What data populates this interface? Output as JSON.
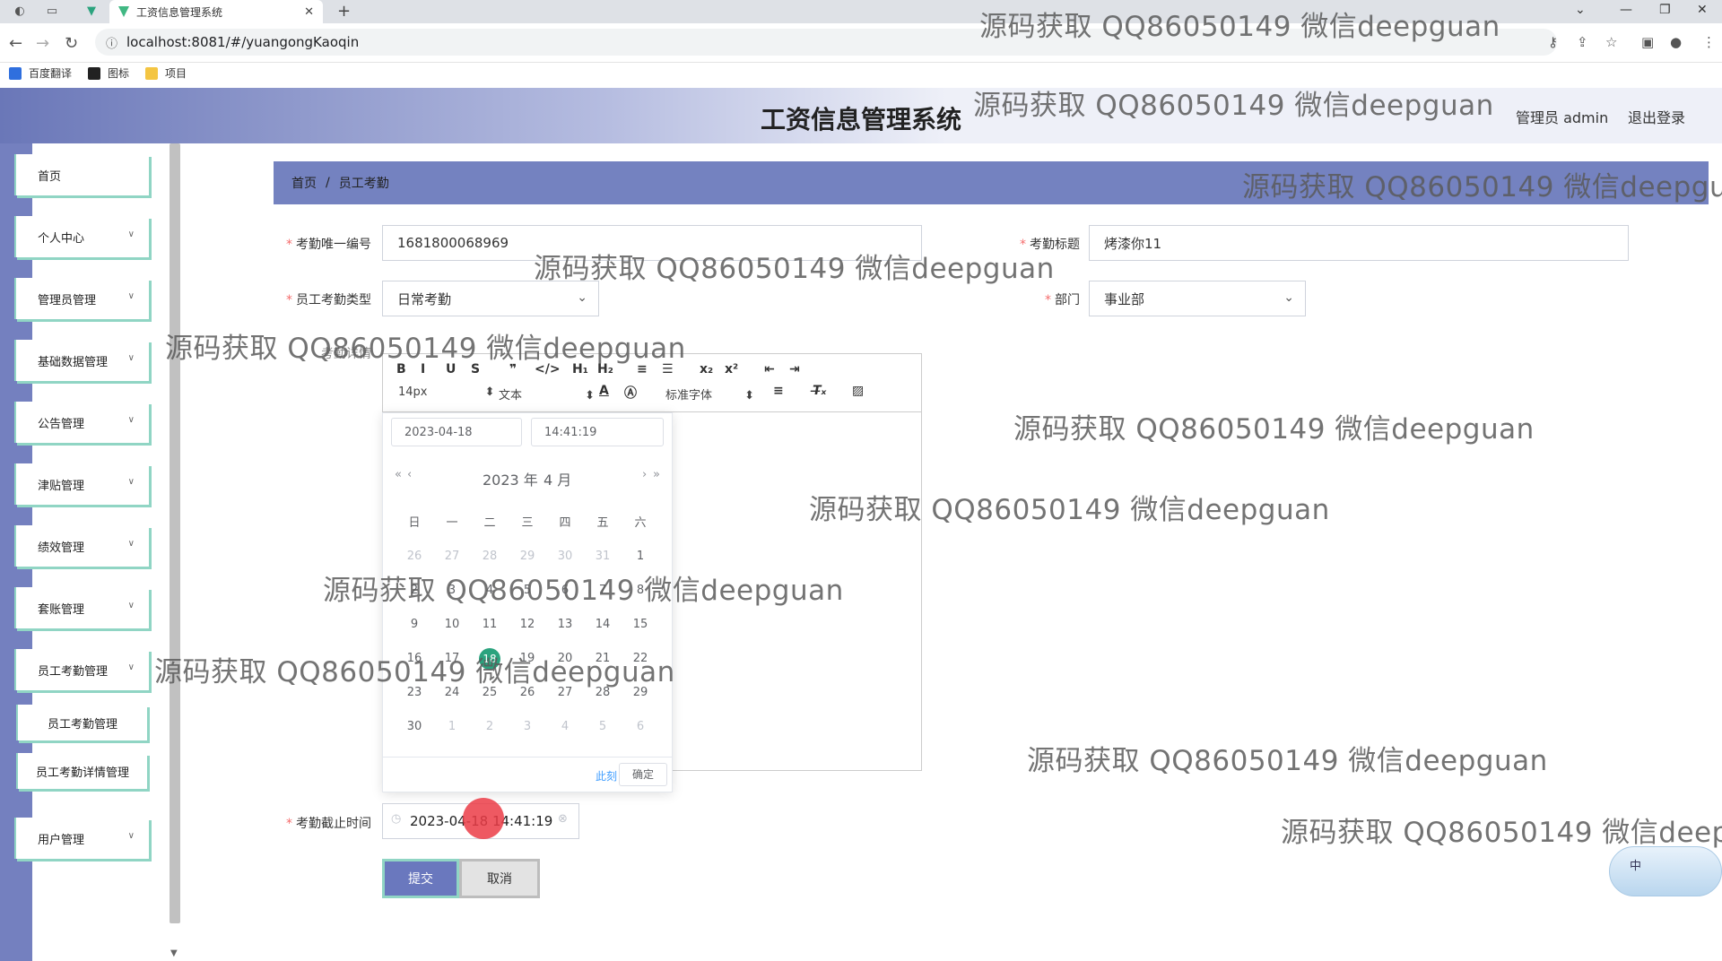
{
  "browser": {
    "tab_title": "工资信息管理系统",
    "url": "localhost:8081/#/yuangongKaoqin",
    "bookmarks": [
      {
        "label": "百度翻译",
        "color": "#2f6fde"
      },
      {
        "label": "图标",
        "color": "#222222"
      },
      {
        "label": "项目",
        "color": "#f4c542"
      }
    ]
  },
  "header": {
    "title": "工资信息管理系统",
    "user": "管理员 admin",
    "logout": "退出登录"
  },
  "sidebar": {
    "items": [
      {
        "label": "首页",
        "has_arrow": false
      },
      {
        "label": "个人中心",
        "has_arrow": true
      },
      {
        "label": "管理员管理",
        "has_arrow": true
      },
      {
        "label": "基础数据管理",
        "has_arrow": true
      },
      {
        "label": "公告管理",
        "has_arrow": true
      },
      {
        "label": "津贴管理",
        "has_arrow": true
      },
      {
        "label": "绩效管理",
        "has_arrow": true
      },
      {
        "label": "套账管理",
        "has_arrow": true
      },
      {
        "label": "员工考勤管理",
        "has_arrow": true
      }
    ],
    "subitems": [
      "员工考勤管理",
      "员工考勤详情管理"
    ],
    "last_item": "用户管理"
  },
  "breadcrumb": {
    "home": "首页",
    "sep": "/",
    "current": "员工考勤"
  },
  "form": {
    "id_label": "考勤唯一编号",
    "id_value": "1681800068969",
    "title_label": "考勤标题",
    "title_value": "烤漆你11",
    "type_label": "员工考勤类型",
    "type_value": "日常考勤",
    "dept_label": "部门",
    "dept_value": "事业部",
    "detail_label": "考勤详情",
    "deadline_label": "考勤截止时间",
    "deadline_value": "2023-04-18 14:41:19",
    "submit": "提交",
    "cancel": "取消"
  },
  "editor": {
    "tools": [
      "B",
      "I",
      "U",
      "S",
      "❞",
      "</>",
      "H₁",
      "H₂",
      "≡",
      "☰",
      "x₂",
      "x²",
      "⇤",
      "⇥"
    ],
    "font_size": "14px",
    "text_type": "文本",
    "font_family": "标准字体"
  },
  "datepicker": {
    "date_value": "2023-04-18",
    "time_value": "14:41:19",
    "year": "2023 年",
    "month": "4 月",
    "weekdays": [
      "日",
      "一",
      "二",
      "三",
      "四",
      "五",
      "六"
    ],
    "weeks": [
      [
        {
          "d": "26",
          "o": true
        },
        {
          "d": "27",
          "o": true
        },
        {
          "d": "28",
          "o": true
        },
        {
          "d": "29",
          "o": true
        },
        {
          "d": "30",
          "o": true
        },
        {
          "d": "31",
          "o": true
        },
        {
          "d": "1",
          "o": false
        }
      ],
      [
        {
          "d": "2",
          "o": false
        },
        {
          "d": "3",
          "o": false
        },
        {
          "d": "4",
          "o": false
        },
        {
          "d": "5",
          "o": false
        },
        {
          "d": "6",
          "o": false
        },
        {
          "d": "7",
          "o": false
        },
        {
          "d": "8",
          "o": false
        }
      ],
      [
        {
          "d": "9",
          "o": false
        },
        {
          "d": "10",
          "o": false
        },
        {
          "d": "11",
          "o": false
        },
        {
          "d": "12",
          "o": false
        },
        {
          "d": "13",
          "o": false
        },
        {
          "d": "14",
          "o": false
        },
        {
          "d": "15",
          "o": false
        }
      ],
      [
        {
          "d": "16",
          "o": false
        },
        {
          "d": "17",
          "o": false
        },
        {
          "d": "18",
          "o": false
        },
        {
          "d": "19",
          "o": false
        },
        {
          "d": "20",
          "o": false
        },
        {
          "d": "21",
          "o": false
        },
        {
          "d": "22",
          "o": false
        }
      ],
      [
        {
          "d": "23",
          "o": false
        },
        {
          "d": "24",
          "o": false
        },
        {
          "d": "25",
          "o": false
        },
        {
          "d": "26",
          "o": false
        },
        {
          "d": "27",
          "o": false
        },
        {
          "d": "28",
          "o": false
        },
        {
          "d": "29",
          "o": false
        }
      ],
      [
        {
          "d": "30",
          "o": false
        },
        {
          "d": "1",
          "o": true
        },
        {
          "d": "2",
          "o": true
        },
        {
          "d": "3",
          "o": true
        },
        {
          "d": "4",
          "o": true
        },
        {
          "d": "5",
          "o": true
        },
        {
          "d": "6",
          "o": true
        }
      ]
    ],
    "selected": "18",
    "now": "此刻",
    "ok": "确定"
  },
  "watermark": "源码获取 QQ86050149 微信deepguan",
  "ime_label": "中"
}
